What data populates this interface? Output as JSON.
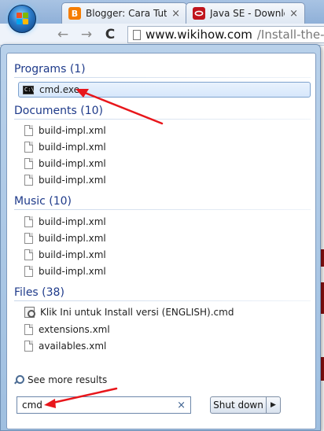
{
  "browser": {
    "tabs": [
      {
        "label": "Blogger: Cara Tutor",
        "icon": "blogger-icon",
        "icon_letter": "B",
        "color": "#f57d00"
      },
      {
        "label": "Java SE - Download",
        "icon": "oracle-icon",
        "icon_letter": "",
        "color": "#c0141c"
      }
    ],
    "tab_close": "×",
    "nav": {
      "back": "←",
      "forward": "→",
      "reload": "C"
    },
    "url_host": "www.wikihow.com",
    "url_path": "/Install-the-Jav"
  },
  "start_menu": {
    "groups": {
      "programs": {
        "header": "Programs (1)",
        "items": [
          {
            "label": "cmd.exe",
            "icon": "command-prompt-icon",
            "icon_text": "C:\\",
            "selected": true
          }
        ]
      },
      "documents": {
        "header": "Documents (10)",
        "items": [
          {
            "label": "build-impl.xml",
            "icon": "document-icon"
          },
          {
            "label": "build-impl.xml",
            "icon": "document-icon"
          },
          {
            "label": "build-impl.xml",
            "icon": "document-icon"
          },
          {
            "label": "build-impl.xml",
            "icon": "document-icon"
          }
        ]
      },
      "music": {
        "header": "Music (10)",
        "items": [
          {
            "label": "build-impl.xml",
            "icon": "document-icon"
          },
          {
            "label": "build-impl.xml",
            "icon": "document-icon"
          },
          {
            "label": "build-impl.xml",
            "icon": "document-icon"
          },
          {
            "label": "build-impl.xml",
            "icon": "document-icon"
          }
        ]
      },
      "files": {
        "header": "Files (38)",
        "items": [
          {
            "label": "Klik Ini untuk Install versi (ENGLISH).cmd",
            "icon": "cmd-file-icon"
          },
          {
            "label": "extensions.xml",
            "icon": "document-icon"
          },
          {
            "label": "availables.xml",
            "icon": "document-icon"
          }
        ]
      }
    },
    "see_more": "See more results",
    "search": {
      "value": "cmd",
      "clear": "×"
    },
    "shutdown": {
      "label": "Shut down",
      "arrow": "▶"
    }
  },
  "colors": {
    "group_header": "#1e3a8a",
    "annotation_arrow": "#e8161b",
    "selection_border": "#7da2ce"
  }
}
